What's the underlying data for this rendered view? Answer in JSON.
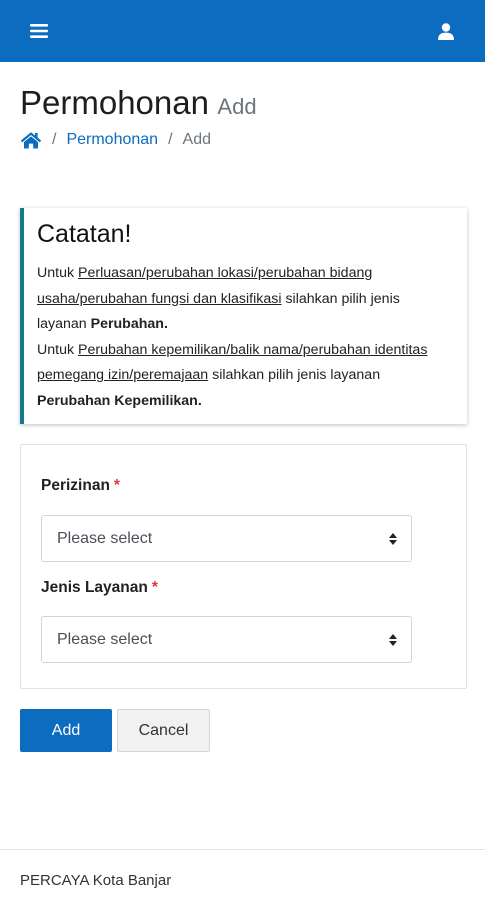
{
  "topbar": {
    "menu_icon": "hamburger-menu-icon",
    "user_icon": "user-icon",
    "color": "#0c6cbf"
  },
  "page": {
    "title": "Permohonan",
    "subtitle": "Add"
  },
  "breadcrumb": {
    "home_icon": "home-icon",
    "items": [
      "Permohonan",
      "Add"
    ],
    "separator": "/"
  },
  "callout": {
    "title": "Catatan!",
    "para1_prefix": "Untuk ",
    "para1_link": "Perluasan/perubahan lokasi/perubahan bidang usaha/perubahan fungsi dan klasifikasi",
    "para1_middle": " silahkan pilih jenis layanan ",
    "para1_bold": "Perubahan.",
    "para2_prefix": "Untuk ",
    "para2_link": "Perubahan kepemilikan/balik nama/perubahan identitas pemegang izin/peremajaan",
    "para2_middle": " silahkan pilih jenis layanan ",
    "para2_bold": "Perubahan Kepemilikan.",
    "accent_color": "#117a8b"
  },
  "form": {
    "perizinan": {
      "label": "Perizinan",
      "required_mark": "*",
      "selected": "Please select"
    },
    "jenis_layanan": {
      "label": "Jenis Layanan",
      "required_mark": "*",
      "selected": "Please select"
    }
  },
  "actions": {
    "add_label": "Add",
    "cancel_label": "Cancel"
  },
  "footer": {
    "text": "PERCAYA Kota Banjar"
  }
}
